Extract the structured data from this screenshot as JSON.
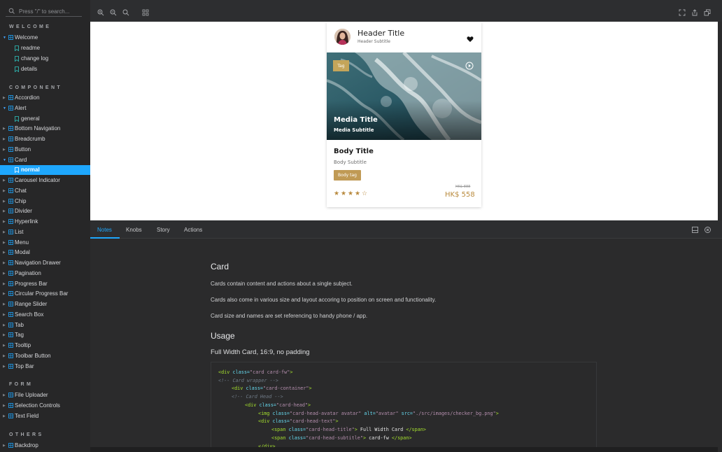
{
  "search": {
    "placeholder": "Press \"/\" to search..."
  },
  "sidebar": {
    "sections": [
      {
        "title": "WELCOME"
      },
      {
        "title": "COMPONENT"
      },
      {
        "title": "FORM"
      },
      {
        "title": "OTHERS"
      }
    ],
    "welcome": {
      "label": "Welcome",
      "children": [
        "readme",
        "change log",
        "details"
      ]
    },
    "components": [
      "Accordion",
      "Alert",
      "general",
      "Bottom Navigation",
      "Breadcrumb",
      "Button",
      "Card",
      "normal",
      "Carousel Indicator",
      "Chat",
      "Chip",
      "Divider",
      "Hyperlink",
      "List",
      "Menu",
      "Modal",
      "Navigation Drawer",
      "Pagination",
      "Progress Bar",
      "Circular Progress Bar",
      "Range Slider",
      "Search Box",
      "Tab",
      "Tag",
      "Tooltip",
      "Toolbar Button",
      "Top Bar"
    ],
    "form": [
      "File Uploader",
      "Selection Controls",
      "Text Field"
    ],
    "others": [
      "Backdrop"
    ]
  },
  "card": {
    "header_title": "Header Title",
    "header_subtitle": "Header Subtitle",
    "media_tag": "Tag",
    "media_title": "Media Title",
    "media_subtitle": "Media Subtitle",
    "body_title": "Body Title",
    "body_subtitle": "Body Subtitle",
    "body_tag": "Body tag",
    "rating": 4,
    "rating_max": 5,
    "price_old": "HK$ 888",
    "price_new": "HK$ 558"
  },
  "addons": {
    "tabs": [
      "Notes",
      "Knobs",
      "Story",
      "Actions"
    ],
    "active_tab": "Notes"
  },
  "notes": {
    "heading": "Card",
    "paragraphs": [
      "Cards contain content and actions about a single subject.",
      "Cards also come in various size and layout accoring to position on screen and functionality.",
      "Card size and names are set referencing to handy phone / app."
    ],
    "usage_heading": "Usage",
    "usage_sub": "Full Width Card, 16:9, no padding"
  },
  "code": {
    "l1_a": "<div ",
    "l1_b": "class=",
    "l1_c": "\"card card-fw\"",
    "l1_d": ">",
    "l2": "<!-- Card wrapper -->",
    "l3_a": "<div ",
    "l3_b": "class=",
    "l3_c": "\"card-container\"",
    "l3_d": ">",
    "l4": "<!-- Card Head -->",
    "l5_a": "<div ",
    "l5_b": "class=",
    "l5_c": "\"card-head\"",
    "l5_d": ">",
    "l6_a": "<img ",
    "l6_b": "class=",
    "l6_c": "\"card-head-avatar avatar\"",
    "l6_d": " alt=",
    "l6_e": "\"avatar\"",
    "l6_f": " src=",
    "l6_g": "\"./src/images/checker_bg.png\"",
    "l6_h": ">",
    "l7_a": "<div ",
    "l7_b": "class=",
    "l7_c": "\"card-head-text\"",
    "l7_d": ">",
    "l8_a": "<span ",
    "l8_b": "class=",
    "l8_c": "\"card-head-title\"",
    "l8_d": ">",
    "l8_e": " Full Width Card ",
    "l8_f": "</span>",
    "l9_a": "<span ",
    "l9_b": "class=",
    "l9_c": "\"card-head-subtitle\"",
    "l9_d": ">",
    "l9_e": " card-fw ",
    "l9_f": "</span>",
    "l10": "</div>"
  },
  "colors": {
    "accent": "#1ea7fd",
    "gold": "#c09a55",
    "sidebar_bg": "#272728"
  }
}
